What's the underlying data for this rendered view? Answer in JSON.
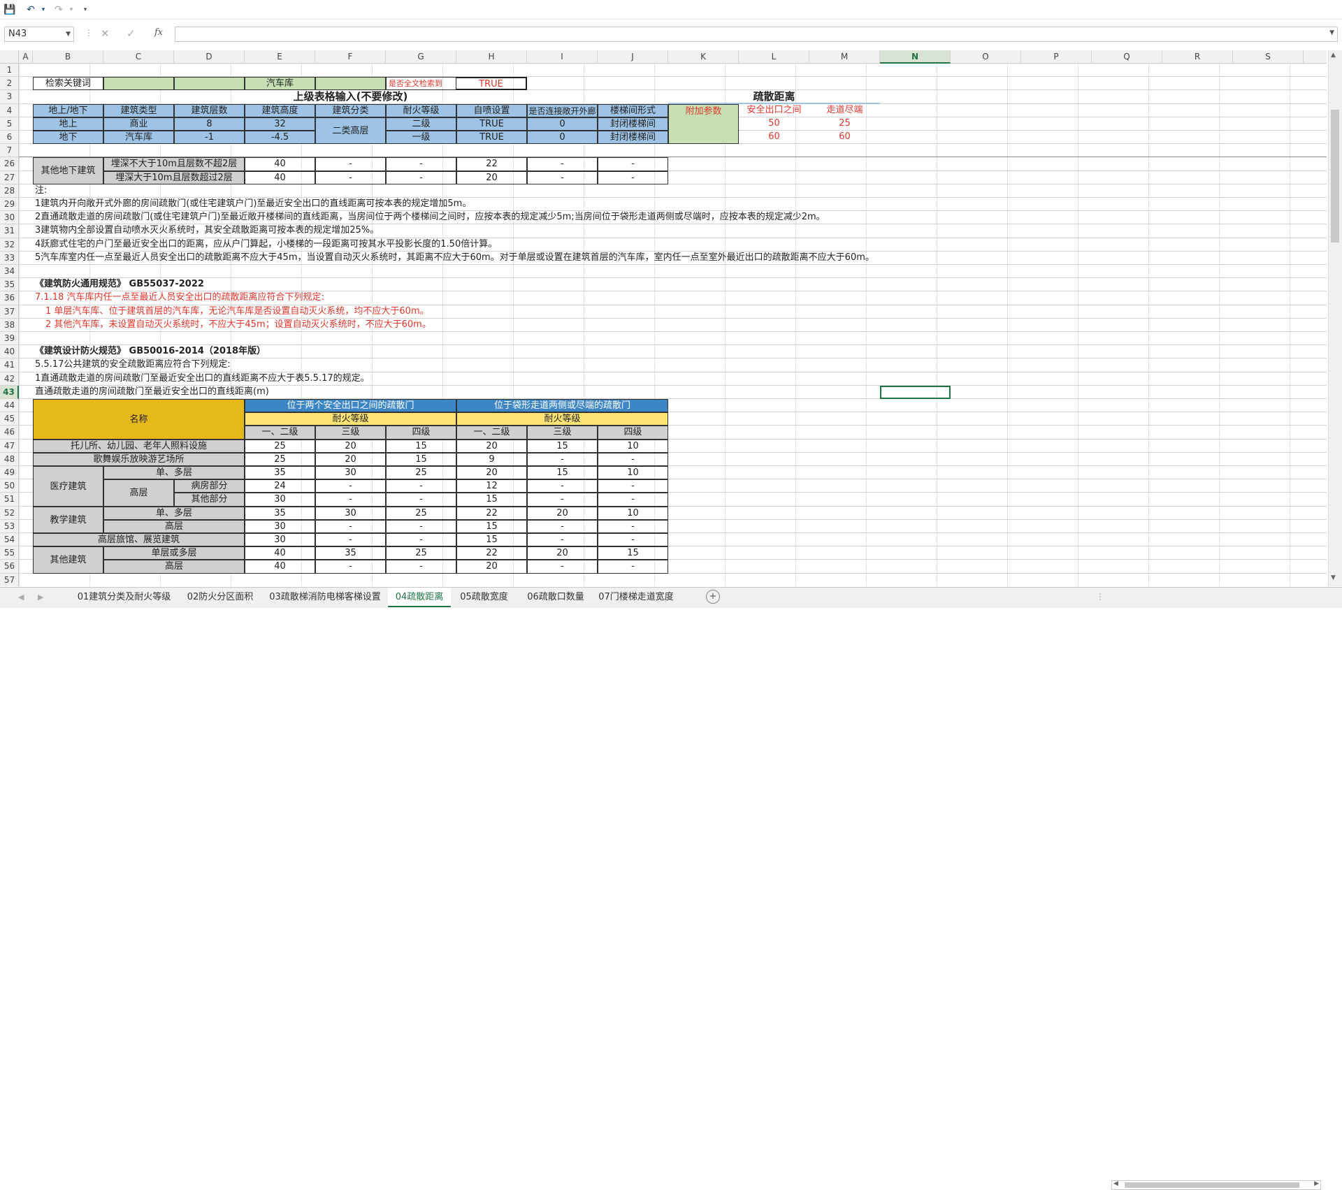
{
  "namebox": "N43",
  "formula": "",
  "columns": [
    "A",
    "B",
    "C",
    "D",
    "E",
    "F",
    "G",
    "H",
    "I",
    "J",
    "K",
    "L",
    "M",
    "N",
    "O",
    "P",
    "Q",
    "R",
    "S"
  ],
  "selected_col": "N",
  "selected_row": "43",
  "rows": [
    "1",
    "2",
    "3",
    "4",
    "5",
    "6",
    "7",
    "26",
    "27",
    "28",
    "29",
    "30",
    "31",
    "32",
    "33",
    "34",
    "35",
    "36",
    "37",
    "38",
    "39",
    "40",
    "41",
    "42",
    "43",
    "44",
    "45",
    "46",
    "47",
    "48",
    "49",
    "50",
    "51",
    "52",
    "53",
    "54",
    "55",
    "56",
    "57"
  ],
  "search": {
    "label": "检索关键词",
    "keyword": "汽车库",
    "fulltext_label": "是否全文检索到",
    "fulltext_value": "TRUE"
  },
  "headings": {
    "upper": "上级表格输入(不要修改)",
    "evac": "疏散距离"
  },
  "input_table": {
    "headers": [
      "地上/地下",
      "建筑类型",
      "建筑层数",
      "建筑高度",
      "建筑分类",
      "耐火等级",
      "自喷设置",
      "是否连接敞开外廊",
      "楼梯间形式"
    ],
    "extra": "附加参数",
    "evac_headers": [
      "安全出口之间",
      "走道尽端"
    ],
    "row1": [
      "地上",
      "商业",
      "8",
      "32",
      "二类高层",
      "二级",
      "TRUE",
      "0",
      "封闭楼梯间"
    ],
    "row2": [
      "地下",
      "汽车库",
      "-1",
      "-4.5",
      "",
      "一级",
      "TRUE",
      "0",
      "封闭楼梯间"
    ],
    "evac1": [
      "50",
      "25"
    ],
    "evac2": [
      "60",
      "60"
    ]
  },
  "under_table": {
    "group": "其他地下建筑",
    "r26": [
      "埋深不大于10m且层数不超2层",
      "40",
      "-",
      "-",
      "22",
      "-",
      "-"
    ],
    "r27": [
      "埋深大于10m且层数超过2层",
      "40",
      "-",
      "-",
      "20",
      "-",
      "-"
    ]
  },
  "notes": [
    "注:",
    "1建筑内开向敞开式外廊的房间疏散门(或住宅建筑户门)至最近安全出口的直线距离可按本表的规定增加5m。",
    "2直通疏散走道的房间疏散门(或住宅建筑户门)至最近敞开楼梯间的直线距离，当房间位于两个楼梯间之间时，应按本表的规定减少5m;当房间位于袋形走道两侧或尽端时，应按本表的规定减少2m。",
    "3建筑物内全部设置自动喷水灭火系统时，其安全疏散距离可按本表的规定增加25%。",
    "4跃廊式住宅的户门至最近安全出口的距离，应从户门算起，小楼梯的一段距离可按其水平投影长度的1.50倍计算。",
    "5汽车库室内任一点至最近人员安全出口的疏散距离不应大于45m，当设置自动灭火系统时，其距离不应大于60m。对于单层或设置在建筑首层的汽车库，室内任一点至室外最近出口的疏散距离不应大于60m。"
  ],
  "gb55037": {
    "title": "《建筑防火通用规范》 GB55037-2022",
    "l1": "7.1.18 汽车库内任一点至最近人员安全出口的疏散距离应符合下列规定:",
    "l2": "1 单层汽车库、位于建筑首层的汽车库，无论汽车库是否设置自动灭火系统，均不应大于60m。",
    "l3": "2 其他汽车库，未设置自动灭火系统时，不应大于45m；设置自动灭火系统时，不应大于60m。"
  },
  "gb50016": {
    "title": "《建筑设计防火规范》 GB50016-2014（2018年版）",
    "l1": "5.5.17公共建筑的安全疏散距离应符合下列规定:",
    "l2": "1直通疏散走道的房间疏散门至最近安全出口的直线距离不应大于表5.5.17的规定。",
    "l3": "直通疏散走道的房间疏散门至最近安全出口的直线距离(m)"
  },
  "big_table": {
    "name": "名称",
    "between": "位于两个安全出口之间的疏散门",
    "dead": "位于袋形走道两侧或尽端的疏散门",
    "fire": "耐火等级",
    "grades": [
      "一、二级",
      "三级",
      "四级"
    ],
    "rows": [
      {
        "label": "托儿所、幼儿园、老年人照料设施",
        "v": [
          "25",
          "20",
          "15",
          "20",
          "15",
          "10"
        ]
      },
      {
        "label": "歌舞娱乐放映游艺场所",
        "v": [
          "25",
          "20",
          "15",
          "9",
          "-",
          "-"
        ]
      },
      {
        "g": "医疗建筑",
        "label": "单、多层",
        "v": [
          "35",
          "30",
          "25",
          "20",
          "15",
          "10"
        ]
      },
      {
        "sub": "高层",
        "label": "病房部分",
        "v": [
          "24",
          "-",
          "-",
          "12",
          "-",
          "-"
        ]
      },
      {
        "label": "其他部分",
        "v": [
          "30",
          "-",
          "-",
          "15",
          "-",
          "-"
        ]
      },
      {
        "g": "教学建筑",
        "label": "单、多层",
        "v": [
          "35",
          "30",
          "25",
          "22",
          "20",
          "10"
        ]
      },
      {
        "label": "高层",
        "v": [
          "30",
          "-",
          "-",
          "15",
          "-",
          "-"
        ]
      },
      {
        "label": "高层旅馆、展览建筑",
        "v": [
          "30",
          "-",
          "-",
          "15",
          "-",
          "-"
        ]
      },
      {
        "g": "其他建筑",
        "label": "单层或多层",
        "v": [
          "40",
          "35",
          "25",
          "22",
          "20",
          "15"
        ]
      },
      {
        "label": "高层",
        "v": [
          "40",
          "-",
          "-",
          "20",
          "-",
          "-"
        ]
      }
    ]
  },
  "tabs": [
    "01建筑分类及耐火等级",
    "02防火分区面积",
    "03疏散梯消防电梯客梯设置",
    "04疏散距离",
    "05疏散宽度",
    "06疏散口数量",
    "07门楼梯走道宽度"
  ],
  "active_tab": "04疏散距离"
}
